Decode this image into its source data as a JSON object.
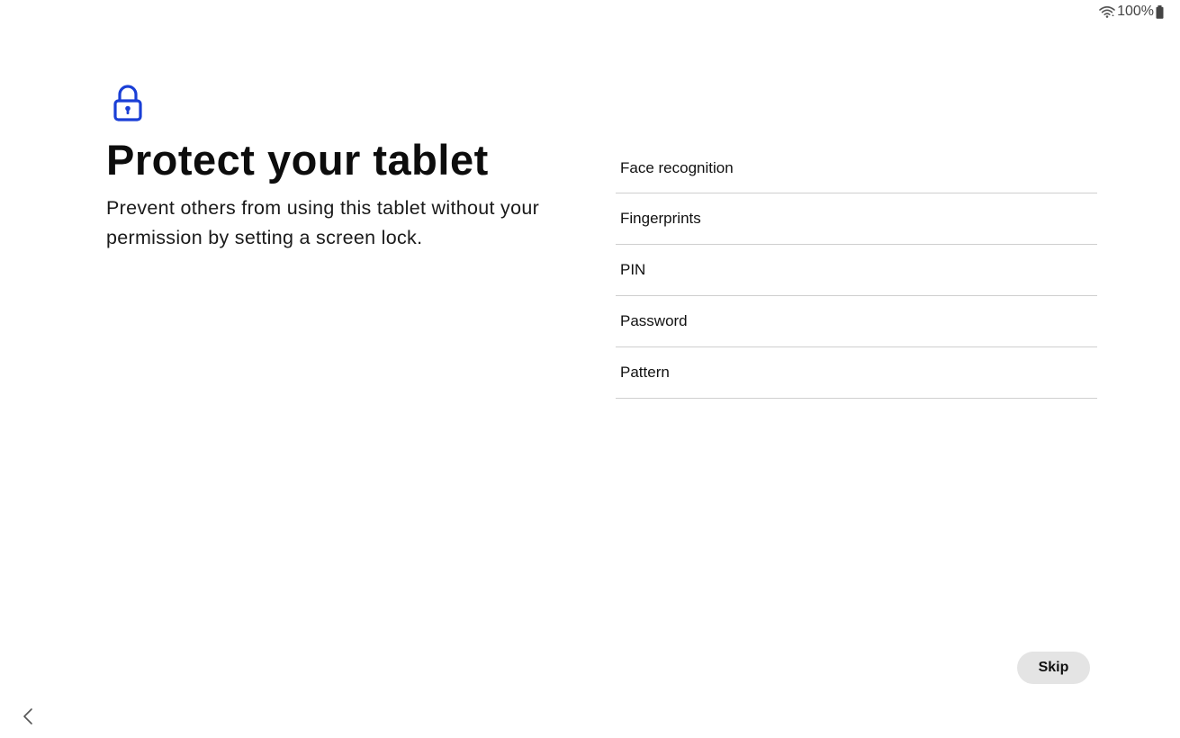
{
  "status_bar": {
    "wifi_icon": "wifi-icon",
    "battery_percent": "100%",
    "battery_icon": "battery-icon"
  },
  "header": {
    "icon": "lock-icon",
    "icon_color": "#1a3fd6",
    "title": "Protect your tablet",
    "description": "Prevent others from using this tablet without your permission by setting a screen lock."
  },
  "options": [
    {
      "label": "Face recognition"
    },
    {
      "label": "Fingerprints"
    },
    {
      "label": "PIN"
    },
    {
      "label": "Password"
    },
    {
      "label": "Pattern"
    }
  ],
  "footer": {
    "skip_label": "Skip",
    "back_icon": "chevron-left-icon"
  }
}
